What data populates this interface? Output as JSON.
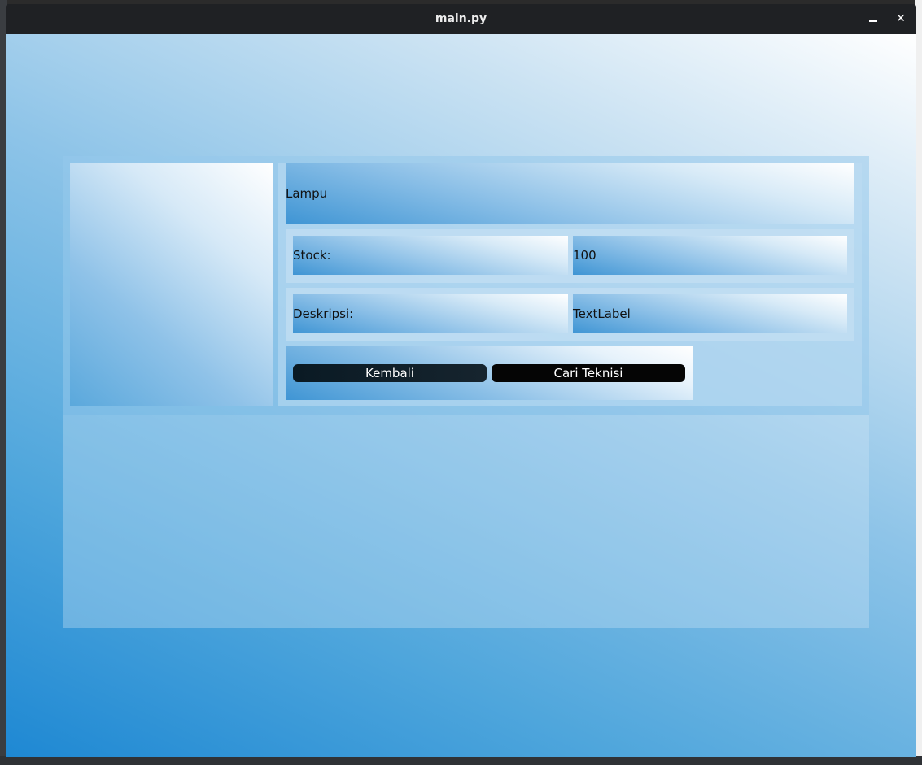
{
  "window": {
    "title": "main.py",
    "minimize_icon": "minimize-icon",
    "close_icon": "close-icon",
    "close_glyph": "✕"
  },
  "product": {
    "name": "Lampu",
    "stock_label": "Stock:",
    "stock_value": "100",
    "description_label": "Deskripsi:",
    "description_value": "TextLabel"
  },
  "actions": {
    "back_label": "Kembali",
    "technician_label": "Cari Teknisi"
  },
  "colors": {
    "gradient_start": "#1e88d3",
    "gradient_end": "#ffffff",
    "button_bg": "#050505",
    "titlebar_bg": "#1f2124"
  }
}
